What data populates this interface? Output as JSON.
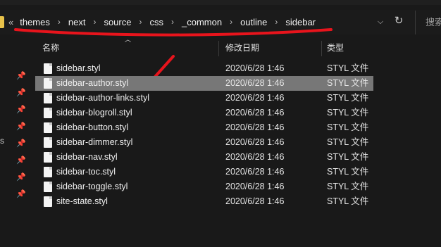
{
  "address": {
    "lead": "«",
    "crumbs": [
      "themes",
      "next",
      "source",
      "css",
      "_common",
      "outline",
      "sidebar"
    ],
    "chevron": "›",
    "dropdown": "⌵",
    "refresh": "↻"
  },
  "search": {
    "placeholder": "搜索"
  },
  "left_pane": {
    "fragment": "s",
    "pin_icon": "📌"
  },
  "columns": {
    "name": "名称",
    "date": "修改日期",
    "type": "类型"
  },
  "files": [
    {
      "name": "sidebar.styl",
      "date": "2020/6/28 1:46",
      "type": "STYL 文件",
      "selected": false
    },
    {
      "name": "sidebar-author.styl",
      "date": "2020/6/28 1:46",
      "type": "STYL 文件",
      "selected": true
    },
    {
      "name": "sidebar-author-links.styl",
      "date": "2020/6/28 1:46",
      "type": "STYL 文件",
      "selected": false
    },
    {
      "name": "sidebar-blogroll.styl",
      "date": "2020/6/28 1:46",
      "type": "STYL 文件",
      "selected": false
    },
    {
      "name": "sidebar-button.styl",
      "date": "2020/6/28 1:46",
      "type": "STYL 文件",
      "selected": false
    },
    {
      "name": "sidebar-dimmer.styl",
      "date": "2020/6/28 1:46",
      "type": "STYL 文件",
      "selected": false
    },
    {
      "name": "sidebar-nav.styl",
      "date": "2020/6/28 1:46",
      "type": "STYL 文件",
      "selected": false
    },
    {
      "name": "sidebar-toc.styl",
      "date": "2020/6/28 1:46",
      "type": "STYL 文件",
      "selected": false
    },
    {
      "name": "sidebar-toggle.styl",
      "date": "2020/6/28 1:46",
      "type": "STYL 文件",
      "selected": false
    },
    {
      "name": "site-state.styl",
      "date": "2020/6/28 1:46",
      "type": "STYL 文件",
      "selected": false
    }
  ],
  "colors": {
    "annotation": "#e8141c",
    "selected_row": "#777777",
    "folder": "#e8c24a"
  }
}
